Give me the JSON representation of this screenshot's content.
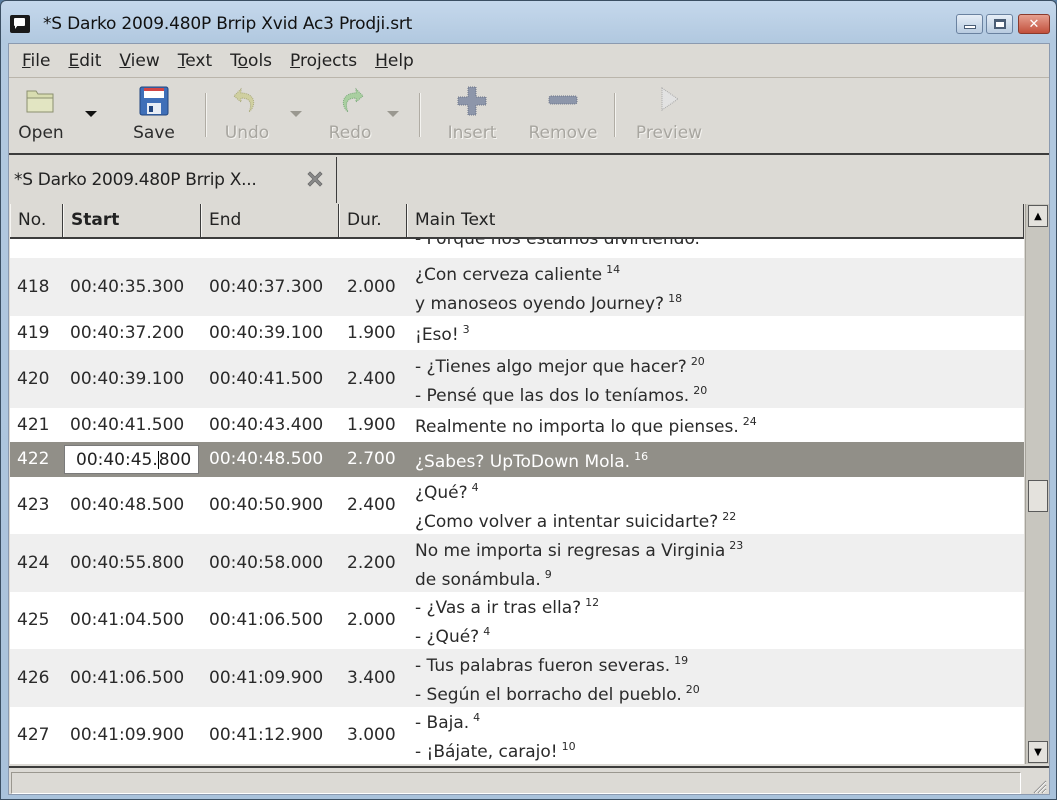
{
  "window": {
    "title": "*S Darko 2009.480P Brrip Xvid Ac3 Prodji.srt",
    "controls": {
      "minimize": "minimize",
      "maximize": "maximize",
      "close": "close"
    }
  },
  "menubar": {
    "items": [
      {
        "label": "File",
        "mnemonic": "F"
      },
      {
        "label": "Edit",
        "mnemonic": "E"
      },
      {
        "label": "View",
        "mnemonic": "V"
      },
      {
        "label": "Text",
        "mnemonic": "T"
      },
      {
        "label": "Tools",
        "mnemonic": "o"
      },
      {
        "label": "Projects",
        "mnemonic": "P"
      },
      {
        "label": "Help",
        "mnemonic": "H"
      }
    ]
  },
  "toolbar": {
    "open": {
      "label": "Open",
      "icon": "folder-open-icon",
      "enabled": true
    },
    "save": {
      "label": "Save",
      "icon": "floppy-disk-icon",
      "enabled": true
    },
    "undo": {
      "label": "Undo",
      "icon": "undo-arrow-icon",
      "enabled": false
    },
    "redo": {
      "label": "Redo",
      "icon": "redo-arrow-icon",
      "enabled": false
    },
    "insert": {
      "label": "Insert",
      "icon": "plus-icon",
      "enabled": false
    },
    "remove": {
      "label": "Remove",
      "icon": "minus-icon",
      "enabled": false
    },
    "preview": {
      "label": "Preview",
      "icon": "play-icon",
      "enabled": false
    }
  },
  "tabs": [
    {
      "label": "*S Darko 2009.480P Brrip X...",
      "active": true
    }
  ],
  "table": {
    "columns": [
      {
        "label": "No.",
        "sorted": false
      },
      {
        "label": "Start",
        "sorted": true
      },
      {
        "label": "End",
        "sorted": false
      },
      {
        "label": "Dur.",
        "sorted": false
      },
      {
        "label": "Main Text",
        "sorted": false
      }
    ],
    "partial_top_row_text": "- Porque nos estamos divirtiendo.",
    "rows": [
      {
        "no": "418",
        "start": "00:40:35.300",
        "end": "00:40:37.300",
        "dur": "2.000",
        "lines": [
          {
            "text": "¿Con cerveza caliente",
            "len": "14"
          },
          {
            "text": "y manoseos oyendo Journey?",
            "len": "18"
          }
        ]
      },
      {
        "no": "419",
        "start": "00:40:37.200",
        "end": "00:40:39.100",
        "dur": "1.900",
        "lines": [
          {
            "text": "¡Eso!",
            "len": "3"
          }
        ]
      },
      {
        "no": "420",
        "start": "00:40:39.100",
        "end": "00:40:41.500",
        "dur": "2.400",
        "lines": [
          {
            "text": "- ¿Tienes algo mejor que hacer?",
            "len": "20"
          },
          {
            "text": "- Pensé que las dos lo teníamos.",
            "len": "20"
          }
        ]
      },
      {
        "no": "421",
        "start": "00:40:41.500",
        "end": "00:40:43.400",
        "dur": "1.900",
        "lines": [
          {
            "text": "Realmente no importa lo que pienses.",
            "len": "24"
          }
        ]
      },
      {
        "no": "422",
        "start": "00:40:45.800",
        "end": "00:40:48.500",
        "dur": "2.700",
        "selected": true,
        "editing_start": true,
        "edit_before_caret": "00:40:45.",
        "edit_after_caret": "800",
        "lines": [
          {
            "text": "¿Sabes? UpToDown Mola.",
            "len": "16"
          }
        ]
      },
      {
        "no": "423",
        "start": "00:40:48.500",
        "end": "00:40:50.900",
        "dur": "2.400",
        "lines": [
          {
            "text": "¿Qué?",
            "len": "4"
          },
          {
            "text": "¿Como volver a intentar suicidarte?",
            "len": "22"
          }
        ]
      },
      {
        "no": "424",
        "start": "00:40:55.800",
        "end": "00:40:58.000",
        "dur": "2.200",
        "lines": [
          {
            "text": "No me importa si regresas a Virginia",
            "len": "23"
          },
          {
            "text": "de sonámbula.",
            "len": "9"
          }
        ]
      },
      {
        "no": "425",
        "start": "00:41:04.500",
        "end": "00:41:06.500",
        "dur": "2.000",
        "lines": [
          {
            "text": "- ¿Vas a ir tras ella?",
            "len": "12"
          },
          {
            "text": "- ¿Qué?",
            "len": "4"
          }
        ]
      },
      {
        "no": "426",
        "start": "00:41:06.500",
        "end": "00:41:09.900",
        "dur": "3.400",
        "lines": [
          {
            "text": "- Tus palabras fueron severas.",
            "len": "19"
          },
          {
            "text": "- Según el borracho del pueblo.",
            "len": "20"
          }
        ]
      },
      {
        "no": "427",
        "start": "00:41:09.900",
        "end": "00:41:12.900",
        "dur": "3.000",
        "lines": [
          {
            "text": "- Baja.",
            "len": "4"
          },
          {
            "text": "- ¡Bájate, carajo!",
            "len": "10"
          }
        ]
      }
    ]
  },
  "scrollbar": {
    "position_fraction": 0.53
  },
  "statusbar": {
    "text": ""
  },
  "colors": {
    "selection_bg": "#918f88",
    "even_row_bg": "#efefef",
    "odd_row_bg": "#ffffff",
    "chrome_bg": "#dcdad5",
    "close_button": "#c2503c"
  }
}
